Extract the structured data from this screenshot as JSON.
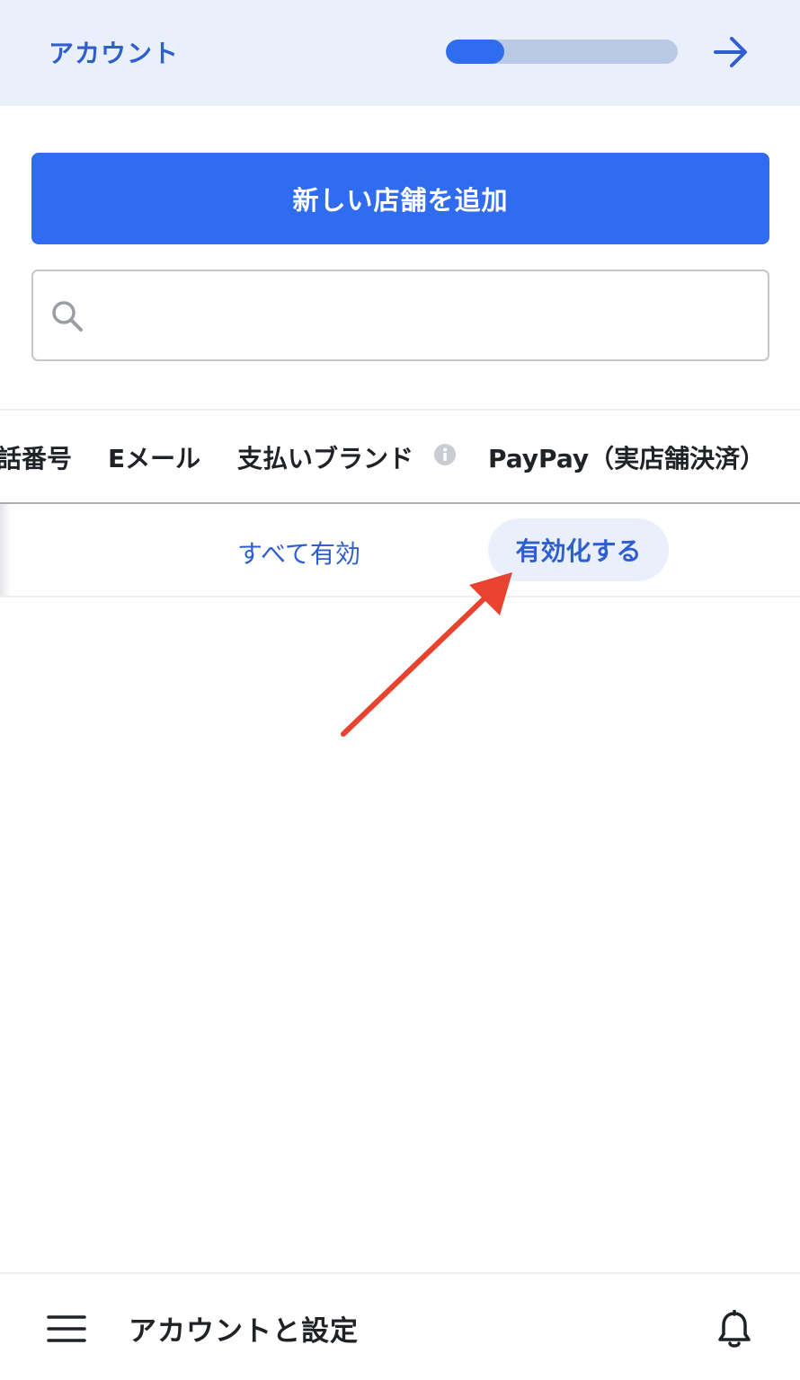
{
  "header": {
    "title": "アカウント",
    "progress": 0.25,
    "next_icon": "arrow-right-icon"
  },
  "main": {
    "add_store_label": "新しい店舗を追加",
    "search": {
      "placeholder": "",
      "value": "",
      "icon": "search-icon"
    }
  },
  "table": {
    "columns": [
      "話番号",
      "Eメール",
      "支払いブランド",
      "PayPay（実店舗決済）"
    ],
    "info_icon": "info-icon",
    "row": {
      "enable_all_label": "すべて有効",
      "enable_button_label": "有効化する"
    }
  },
  "annotation": {
    "icon": "red-arrow-icon",
    "color": "#e8432e"
  },
  "bottom_bar": {
    "title": "アカウントと設定",
    "menu_icon": "hamburger-menu-icon",
    "bell_icon": "bell-icon"
  },
  "colors": {
    "accent": "#2f6cf0",
    "header_bg": "#e9f0fc",
    "link": "#2f5fcf"
  }
}
